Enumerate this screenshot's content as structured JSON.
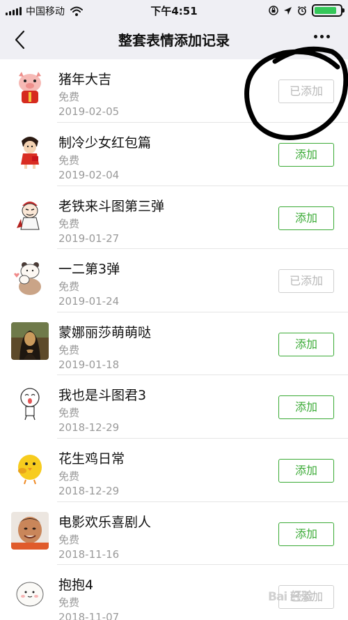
{
  "status_bar": {
    "carrier": "中国移动",
    "time": "下午4:51",
    "battery_level": 0.85,
    "icons": [
      "signal-icon",
      "wifi-icon",
      "rotation-lock-icon",
      "location-icon",
      "alarm-icon",
      "battery-icon"
    ]
  },
  "nav": {
    "title": "整套表情添加记录",
    "back_icon": "chevron-left-icon",
    "more_icon": "more-dots-icon"
  },
  "colors": {
    "accent": "#3aaa35",
    "muted_text": "#9a9a9a",
    "header_bg": "#efeff4",
    "scribble": "#000000"
  },
  "items": [
    {
      "name": "猪年大吉",
      "price": "免费",
      "date": "2019-02-05",
      "button": "已添加",
      "added": true,
      "icon": "pig-sticker-thumbnail"
    },
    {
      "name": "制冷少女红包篇",
      "price": "免费",
      "date": "2019-02-04",
      "button": "添加",
      "added": false,
      "icon": "girl-sticker-thumbnail"
    },
    {
      "name": "老铁来斗图第三弹",
      "price": "免费",
      "date": "2019-01-27",
      "button": "添加",
      "added": false,
      "icon": "cartoon-man-thumbnail"
    },
    {
      "name": "一二第3弹",
      "price": "免费",
      "date": "2019-01-24",
      "button": "已添加",
      "added": true,
      "icon": "bear-sticker-thumbnail"
    },
    {
      "name": "蒙娜丽莎萌萌哒",
      "price": "免费",
      "date": "2019-01-18",
      "button": "添加",
      "added": false,
      "icon": "mona-lisa-thumbnail"
    },
    {
      "name": "我也是斗图君3",
      "price": "免费",
      "date": "2018-12-29",
      "button": "添加",
      "added": false,
      "icon": "doodle-face-thumbnail"
    },
    {
      "name": "花生鸡日常",
      "price": "免费",
      "date": "2018-12-29",
      "button": "添加",
      "added": false,
      "icon": "chick-sticker-thumbnail"
    },
    {
      "name": "电影欢乐喜剧人",
      "price": "免费",
      "date": "2018-11-16",
      "button": "添加",
      "added": false,
      "icon": "comedian-face-thumbnail"
    },
    {
      "name": "抱抱4",
      "price": "免费",
      "date": "2018-11-07",
      "button": "已添加",
      "added": true,
      "icon": "hug-sticker-thumbnail"
    }
  ],
  "watermark": "Bai 经验"
}
